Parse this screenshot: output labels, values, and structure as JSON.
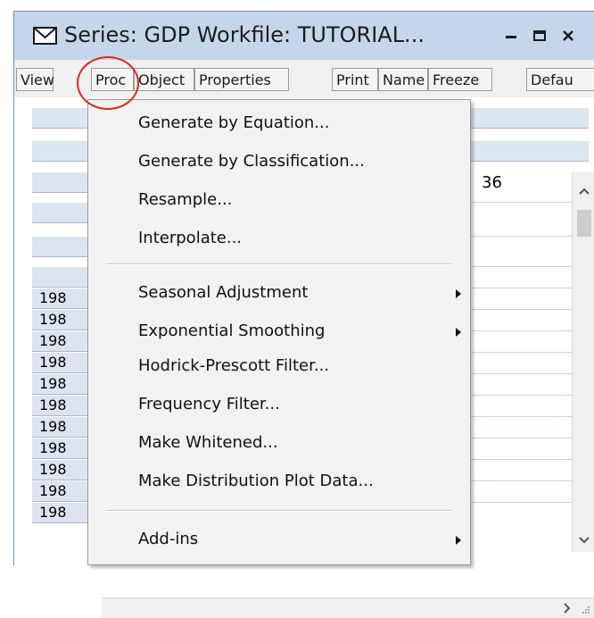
{
  "window": {
    "title": "Series: GDP   Workfile: TUTORIAL...",
    "controls": {
      "minimize": "minimize-icon",
      "maximize": "maximize-icon",
      "close": "close-icon"
    }
  },
  "toolbar": {
    "buttons": [
      "View",
      "Proc",
      "Object",
      "Properties",
      "Print",
      "Name",
      "Freeze",
      "Defau"
    ]
  },
  "spreadsheet": {
    "row_labels": [
      "",
      "",
      "",
      "",
      "",
      "198",
      "198",
      "198",
      "198",
      "198",
      "198",
      "198",
      "198",
      "198",
      "198",
      "198"
    ],
    "visible_value": "36"
  },
  "menu": {
    "items": [
      "Generate by Equation...",
      "Generate by Classification...",
      "Resample...",
      "Interpolate...",
      "Seasonal Adjustment",
      "Exponential Smoothing",
      "Hodrick-Prescott Filter...",
      "Frequency Filter...",
      "Make Whitened...",
      "Make Distribution Plot Data...",
      "Add-ins"
    ]
  },
  "annotation": {
    "color": "#e0281e"
  }
}
